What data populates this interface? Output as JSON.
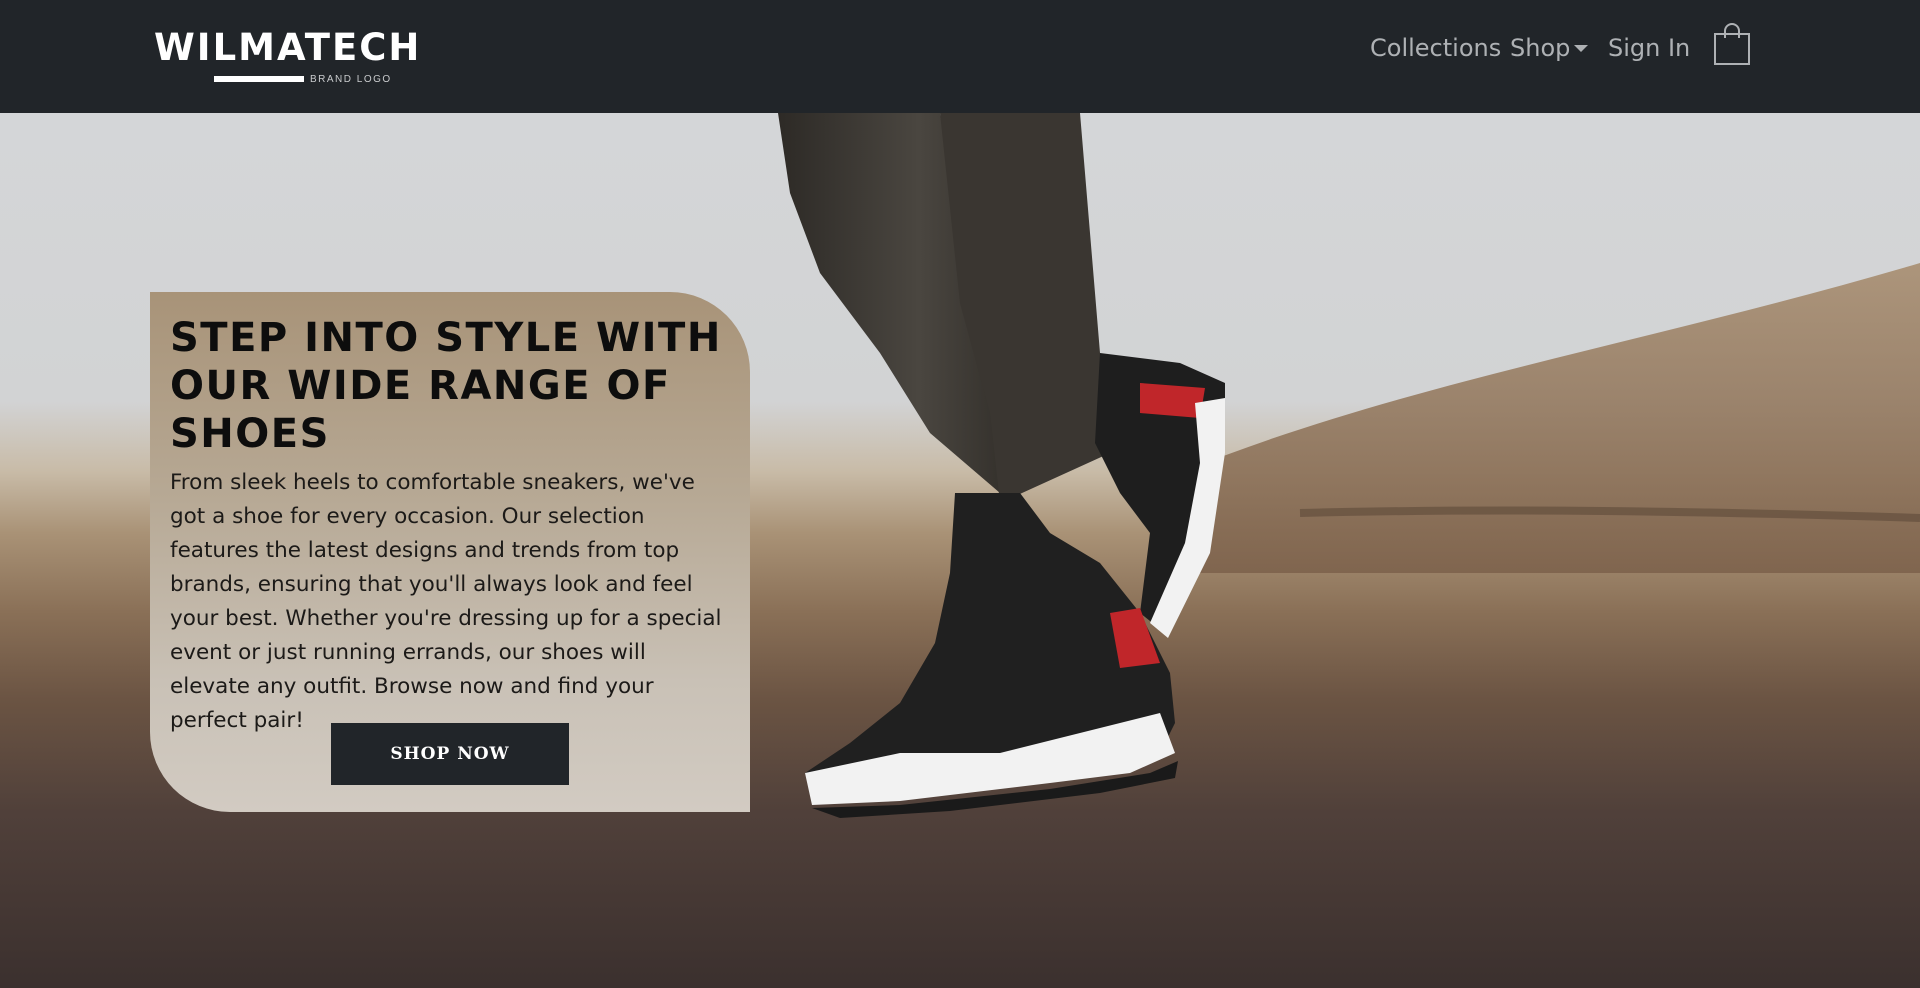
{
  "header": {
    "brand_name": "WILMATECH",
    "brand_tagline": "BRAND LOGO",
    "nav": {
      "collections": "Collections",
      "shop": "Shop",
      "sign_in": "Sign In"
    },
    "icons": {
      "shop_dropdown": "caret-down-icon",
      "cart": "shopping-bag-icon"
    }
  },
  "hero": {
    "title": "STEP INTO STYLE WITH OUR WIDE RANGE OF SHOES",
    "description": "From sleek heels to comfortable sneakers, we've got a shoe for every occasion. Our selection features the latest designs and trends from top brands, ensuring that you'll always look and feel your best. Whether you're dressing up for a special event or just running errands, our shoes will elevate any outfit. Browse now and find your perfect pair!",
    "cta_label": "SHOP NOW",
    "image": "hero-sneaker-photo"
  },
  "colors": {
    "navbar_bg": "#212529",
    "nav_text": "#aeb1b4",
    "button_bg": "#212529",
    "button_text": "#ffffff"
  }
}
